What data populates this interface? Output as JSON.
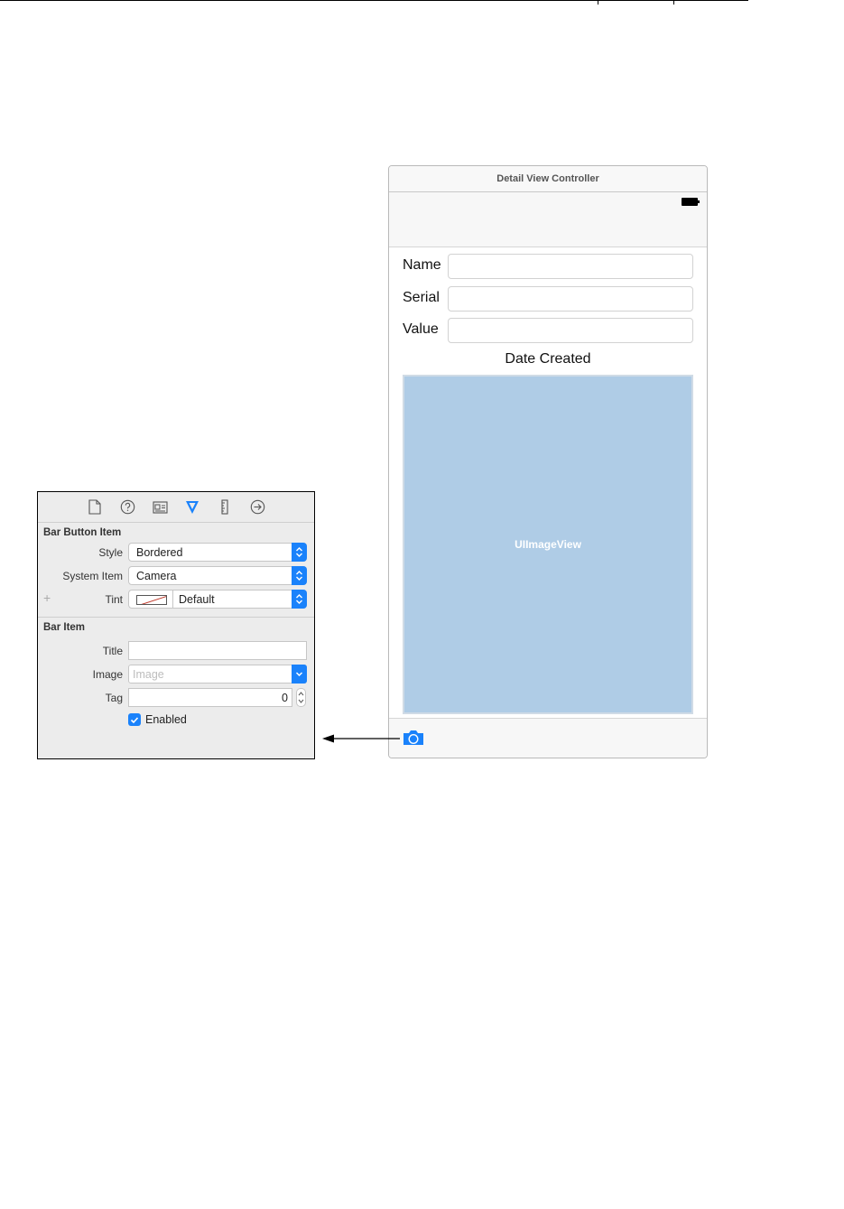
{
  "scene": {
    "title": "Detail View Controller",
    "fields": [
      {
        "label": "Name",
        "value": ""
      },
      {
        "label": "Serial",
        "value": ""
      },
      {
        "label": "Value",
        "value": ""
      }
    ],
    "date_label": "Date Created",
    "image_view_label": "UIImageView",
    "toolbar_item_icon": "camera-icon"
  },
  "inspector": {
    "tab_icons": [
      "file-icon",
      "help-icon",
      "identity-icon",
      "attributes-icon",
      "size-icon",
      "connections-icon"
    ],
    "bar_button_item": {
      "section_title": "Bar Button Item",
      "style_label": "Style",
      "style_value": "Bordered",
      "system_item_label": "System Item",
      "system_item_value": "Camera",
      "tint_label": "Tint",
      "tint_value": "Default",
      "plus": "+"
    },
    "bar_item": {
      "section_title": "Bar Item",
      "title_label": "Title",
      "title_value": "",
      "image_label": "Image",
      "image_placeholder": "Image",
      "tag_label": "Tag",
      "tag_value": "0",
      "enabled_label": "Enabled",
      "enabled": true
    }
  },
  "colors": {
    "accent": "#1a82fb",
    "image_view_fill": "#afcce6"
  }
}
